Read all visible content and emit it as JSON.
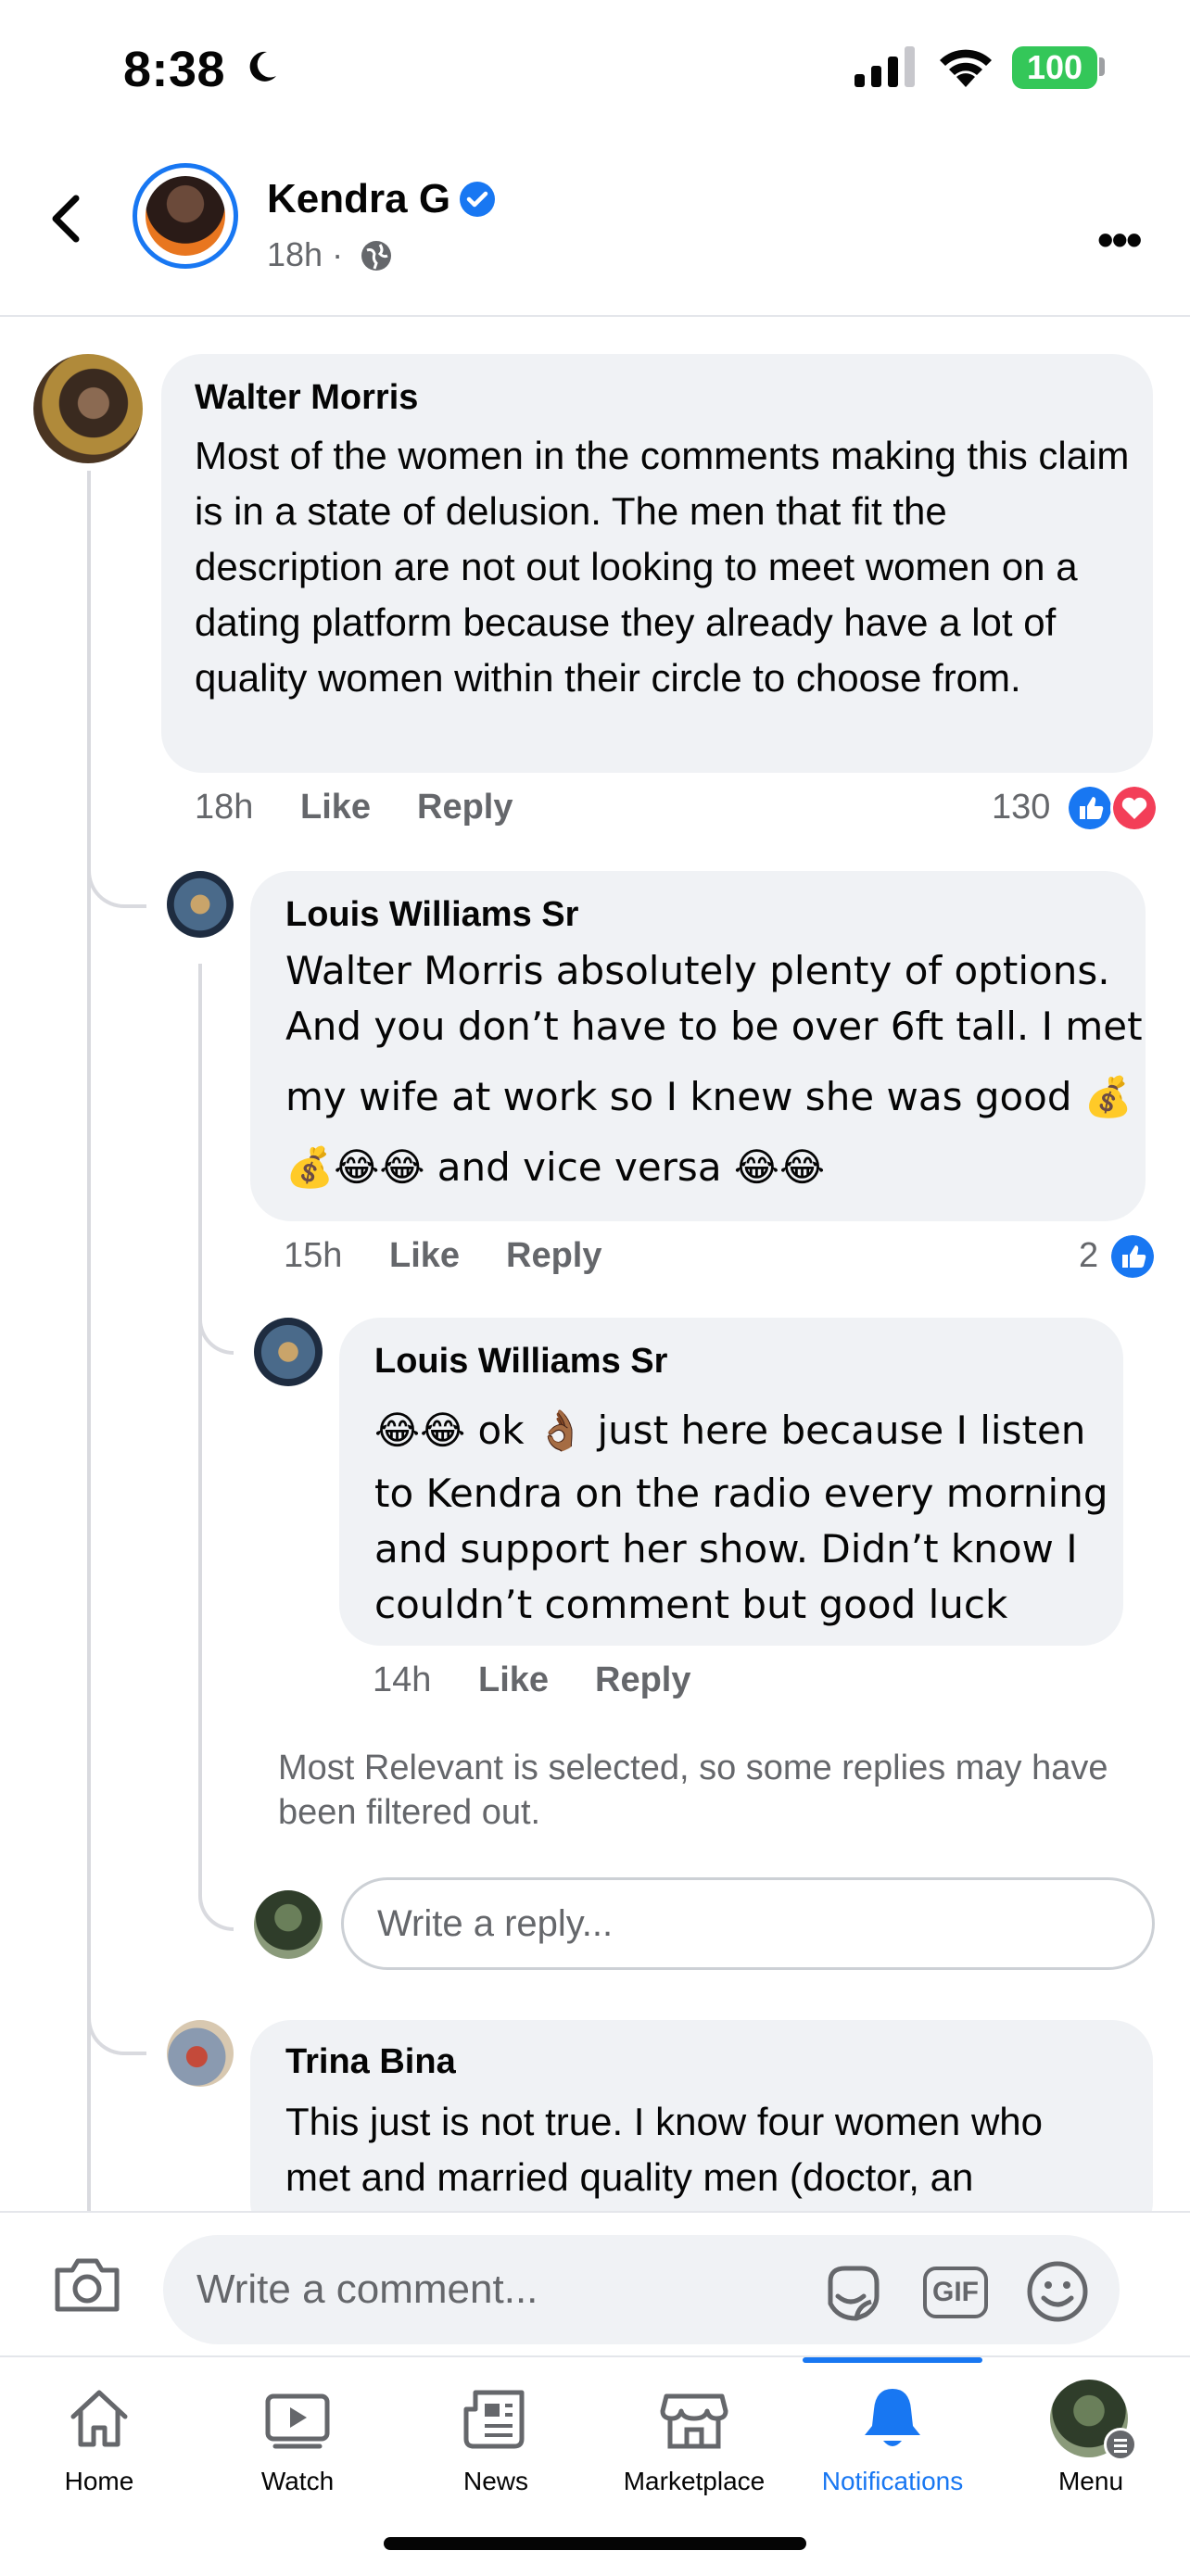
{
  "status_bar": {
    "time": "8:38",
    "battery": "100"
  },
  "post_header": {
    "author": "Kendra G",
    "time": "18h ·"
  },
  "comments": [
    {
      "name": "Walter Morris",
      "text": "Most of the women in the comments making this claim is in a state of delusion. The men that fit the description are not out looking to meet women on a dating platform because they already have a lot of quality women within their circle to choose from.",
      "time": "18h",
      "like": "Like",
      "reply": "Reply",
      "reaction_count": "130"
    },
    {
      "name": "Louis Williams Sr",
      "text_line1": "Walter Morris absolutely plenty of options.",
      "text_line2": "And you don’t have to be over 6ft tall. I met",
      "text_line3": "my wife at work so I knew she was good 💰",
      "text_line4": "💰😂😂 and vice versa 😂😂",
      "time": "15h",
      "like": "Like",
      "reply": "Reply",
      "reaction_count": "2"
    },
    {
      "name": "Louis Williams Sr",
      "text_line1": "😂😂 ok 👌🏾 just here because I listen",
      "text_line2": "to Kendra on the radio every morning",
      "text_line3": "and support  her show. Didn’t know I",
      "text_line4": "couldn’t comment but good luck",
      "time": "14h",
      "like": "Like",
      "reply": "Reply"
    },
    {
      "name": "Trina Bina",
      "text_line1": "This just is not true. I know four women who",
      "text_line2": "met and married quality men (doctor, an"
    }
  ],
  "filter_note": "Most Relevant is selected, so some replies may have been filtered out.",
  "reply_placeholder": "Write a reply...",
  "composer": {
    "placeholder": "Write a comment...",
    "gif_label": "GIF"
  },
  "tabs": [
    {
      "label": "Home",
      "icon": "home-icon"
    },
    {
      "label": "Watch",
      "icon": "watch-icon"
    },
    {
      "label": "News",
      "icon": "news-icon"
    },
    {
      "label": "Marketplace",
      "icon": "marketplace-icon"
    },
    {
      "label": "Notifications",
      "icon": "bell-icon",
      "active": true
    },
    {
      "label": "Menu",
      "icon": "menu-avatar"
    }
  ],
  "colors": {
    "accent": "#1877f2",
    "bubble": "#f0f2f5",
    "secondary_text": "#65676b",
    "love": "#f33e58"
  }
}
